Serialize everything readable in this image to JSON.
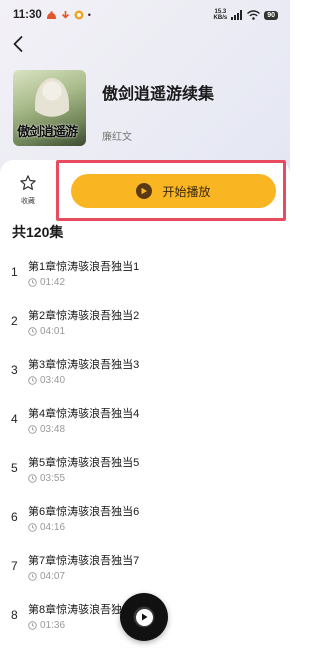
{
  "status_bar": {
    "time": "11:30",
    "net_speed_value": "15.3",
    "net_speed_unit": "KB/s",
    "battery": "90"
  },
  "book": {
    "title": "傲剑逍遥游续集",
    "author": "廉红文",
    "cover_text": "傲剑逍遥游"
  },
  "actions": {
    "favorite_label": "收藏",
    "play_label": "开始播放"
  },
  "episode_count": "共120集",
  "episodes": [
    {
      "num": "1",
      "title": "第1章惊涛骇浪吾独当1",
      "duration": "01:42"
    },
    {
      "num": "2",
      "title": "第2章惊涛骇浪吾独当2",
      "duration": "04:01"
    },
    {
      "num": "3",
      "title": "第3章惊涛骇浪吾独当3",
      "duration": "03:40"
    },
    {
      "num": "4",
      "title": "第4章惊涛骇浪吾独当4",
      "duration": "03:48"
    },
    {
      "num": "5",
      "title": "第5章惊涛骇浪吾独当5",
      "duration": "03:55"
    },
    {
      "num": "6",
      "title": "第6章惊涛骇浪吾独当6",
      "duration": "04:16"
    },
    {
      "num": "7",
      "title": "第7章惊涛骇浪吾独当7",
      "duration": "04:07"
    },
    {
      "num": "8",
      "title": "第8章惊涛骇浪吾独",
      "duration": "01:36"
    }
  ],
  "colors": {
    "accent": "#f9b522",
    "highlight": "#e84a5f"
  }
}
